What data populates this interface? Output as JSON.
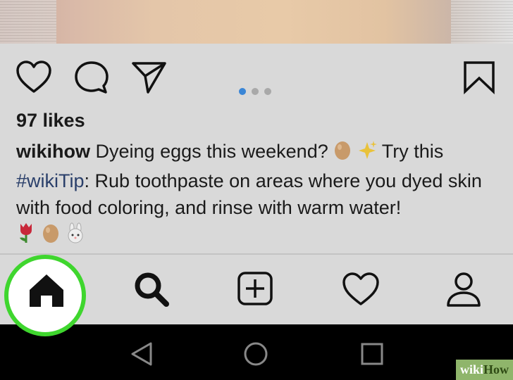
{
  "post": {
    "likes": "97 likes",
    "caption_user": "wikihow",
    "caption_text_1": " Dyeing eggs this weekend? ",
    "caption_text_2": " Try this",
    "hashtag": "#wikiTip",
    "caption_text_3": ": Rub toothpaste on areas where you dyed skin with food coloring, and rinse with warm water!",
    "carousel_dots": 3,
    "carousel_active": 1
  },
  "icons": {
    "like": "heart-icon",
    "comment": "comment-icon",
    "share": "send-icon",
    "save": "bookmark-icon",
    "home": "home-icon",
    "search": "search-icon",
    "new_post": "add-post-icon",
    "activity": "heart-icon",
    "profile": "profile-icon",
    "android_back": "back-triangle-icon",
    "android_home": "home-circle-icon",
    "android_recents": "recents-square-icon"
  },
  "colors": {
    "highlight_ring": "#3fd62e",
    "active_dot": "#3a86d6",
    "hashtag": "#2a3f6a"
  },
  "brand": {
    "wiki": "wiki",
    "how": "How"
  }
}
